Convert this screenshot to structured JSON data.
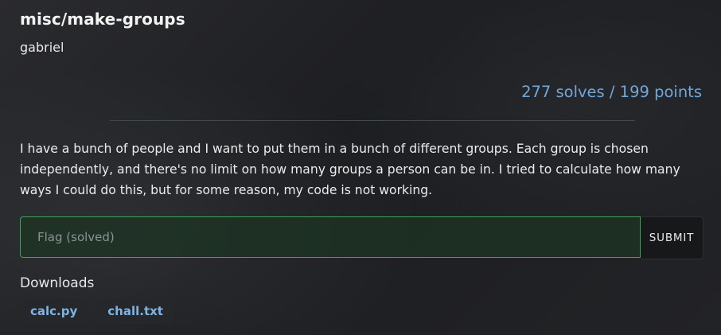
{
  "challenge": {
    "title": "misc/make-groups",
    "author": "gabriel",
    "stats": "277 solves / 199 points",
    "description": "I have a bunch of people and I want to put them in a bunch of different groups. Each group is chosen independently, and there's no limit on how many groups a person can be in. I tried to calculate how many ways I could do this, but for some reason, my code is not working."
  },
  "flag_form": {
    "placeholder": "Flag (solved)",
    "value": "",
    "submit_label": "SUBMIT"
  },
  "downloads": {
    "heading": "Downloads",
    "files": [
      "calc.py",
      "chall.txt"
    ]
  },
  "colors": {
    "accent_blue": "#6fa7db",
    "input_border_green": "#3fa45a"
  }
}
